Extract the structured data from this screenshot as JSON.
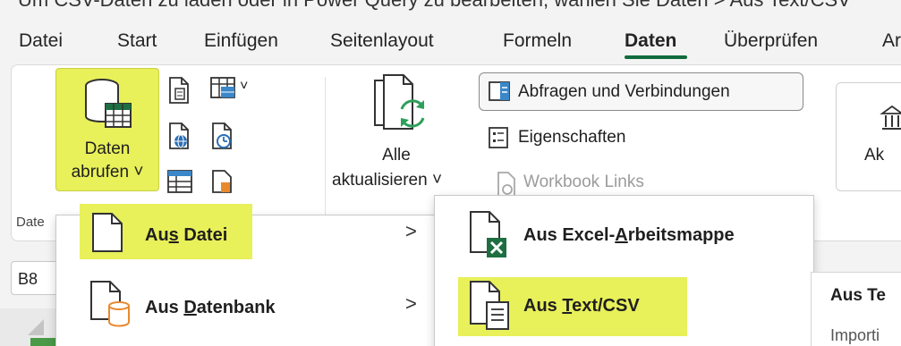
{
  "caption_clipped": "Um CSV-Daten zu laden oder in Power Query zu bearbeiten, wählen Sie Daten > Aus Text/CSV",
  "menu_bar": {
    "items": [
      "Datei",
      "Start",
      "Einfügen",
      "Seitenlayout",
      "Formeln",
      "Daten",
      "Überprüfen",
      "Ar"
    ],
    "active": "Daten"
  },
  "ribbon": {
    "get_data": {
      "line1": "Daten",
      "line2": "abrufen",
      "chevron": "˅"
    },
    "refresh_all": {
      "line1": "Alle",
      "line2": "aktualisieren",
      "chevron": "˅"
    },
    "queries_connections": "Abfragen und Verbindungen",
    "properties": "Eigenschaften",
    "workbook_links": "Workbook Links",
    "right_button_clipped": "Ak",
    "group_label_clipped": "Date",
    "small_icon_chevron": "˅"
  },
  "name_box": {
    "value": "B8"
  },
  "menu_primary": {
    "items": [
      {
        "prefix": "Au",
        "underline": "s",
        "suffix": " Datei",
        "chevron": ">"
      },
      {
        "prefix": "Aus ",
        "underline": "D",
        "suffix": "atenbank",
        "chevron": ">"
      }
    ]
  },
  "menu_secondary": {
    "items": [
      {
        "prefix": "Aus Excel-",
        "underline": "A",
        "suffix": "rbeitsmappe"
      },
      {
        "prefix": "Aus ",
        "underline": "T",
        "suffix": "ext/CSV"
      }
    ]
  },
  "tooltip": {
    "title_clipped": "Aus Te",
    "body_clipped": "Importi"
  },
  "colors": {
    "highlight": "#e8f05a",
    "excel_green": "#1d6f42",
    "refresh_green": "#2e9f5b",
    "database_orange": "#e8892e",
    "underline_green": "#0f6b3b"
  }
}
